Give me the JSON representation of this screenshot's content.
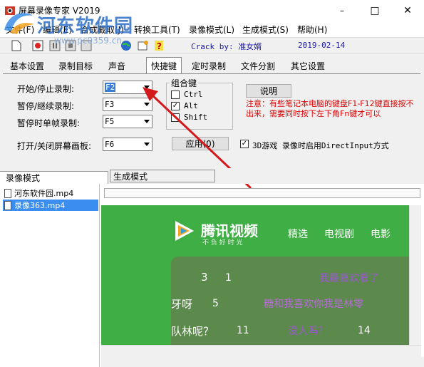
{
  "window": {
    "title": "屏幕录像专家 V2019",
    "minimize": "–",
    "maximize": "□",
    "close": "✕"
  },
  "watermark": {
    "text": "河东软件园",
    "url": "www.pc0359.cn"
  },
  "menu": [
    "文件(F)",
    "编辑(E)",
    "合成截取(J)",
    "转换工具(T)",
    "录像模式(L)",
    "生成模式(S)",
    "帮助(H)"
  ],
  "toolbar": {
    "crack": "Crack by: 准女婿",
    "date": "2019-02-14"
  },
  "tabs": [
    "基本设置",
    "录制目标",
    "声音",
    "快捷键",
    "定时录制",
    "文件分割",
    "其它设置"
  ],
  "hotkeys": {
    "start_stop_label": "开始/停止录制:",
    "start_stop_value": "F2",
    "pause_label": "暂停/继续录制:",
    "pause_value": "F3",
    "single_frame_label": "暂停时单帧录制:",
    "single_frame_value": "F5",
    "draw_label": "打开/关闭屏幕画板:",
    "draw_value": "F6"
  },
  "combo_keys": {
    "title": "组合键",
    "ctrl_label": "Ctrl",
    "ctrl_checked": false,
    "alt_label": "Alt",
    "alt_checked": true,
    "shift_label": "Shift",
    "shift_checked": false
  },
  "buttons": {
    "explain": "说明",
    "apply": "应用(0)"
  },
  "note": "注意：有些笔记本电脑的键盘F1-F12键直接按不出来，需要同时按下左下角Fn键才可以",
  "directinput": {
    "label": "3D游戏 录像时启用DirectInput方式",
    "checked": true
  },
  "lower_tabs": {
    "record_mode": "录像模式",
    "gen_mode": "生成模式"
  },
  "files": [
    {
      "name": "河东软件园.mp4",
      "selected": false
    },
    {
      "name": "录像363.mp4",
      "selected": true
    }
  ],
  "preview": {
    "brand": "腾讯视频",
    "slogan": "不 负 好 时 光",
    "nav": [
      "精选",
      "电视剧",
      "电影"
    ],
    "comments": [
      {
        "text": "3",
        "suffix": "1",
        "bubble": "我最喜欢看了"
      },
      {
        "text": "牙呀",
        "suffix": "5",
        "bubble": "糖和我喜欢你我是林零"
      },
      {
        "text": "队林呢？",
        "suffix": "11",
        "bubble": "没人吗？",
        "likes": "14"
      }
    ]
  },
  "colors": {
    "accent": "#3a7bd5",
    "note": "#e00000",
    "toolbar_text": "#1a1aa6",
    "preview_green": "#3fae45"
  }
}
